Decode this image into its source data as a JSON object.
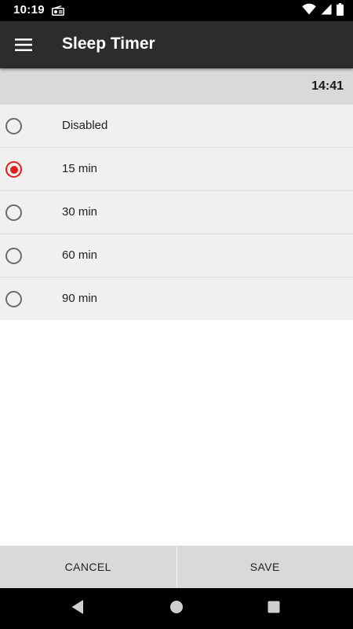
{
  "status_bar": {
    "time": "10:19",
    "icons": [
      "radio-icon",
      "wifi-icon",
      "cell-signal-icon",
      "battery-icon"
    ]
  },
  "app_bar": {
    "menu_icon": "menu-icon",
    "title": "Sleep Timer"
  },
  "header": {
    "current_time": "14:41"
  },
  "options": [
    {
      "label": "Disabled",
      "selected": false
    },
    {
      "label": "15 min",
      "selected": true
    },
    {
      "label": "30 min",
      "selected": false
    },
    {
      "label": "60 min",
      "selected": false
    },
    {
      "label": "90 min",
      "selected": false
    }
  ],
  "actions": {
    "cancel_label": "CANCEL",
    "save_label": "SAVE"
  },
  "nav_bar": {
    "icons": [
      "back-icon",
      "home-icon",
      "recents-icon"
    ]
  },
  "colors": {
    "accent": "#e0201b",
    "app_bar": "#2c2c2c",
    "list_background": "#f0f0f0",
    "header_background": "#d9d9d9"
  }
}
